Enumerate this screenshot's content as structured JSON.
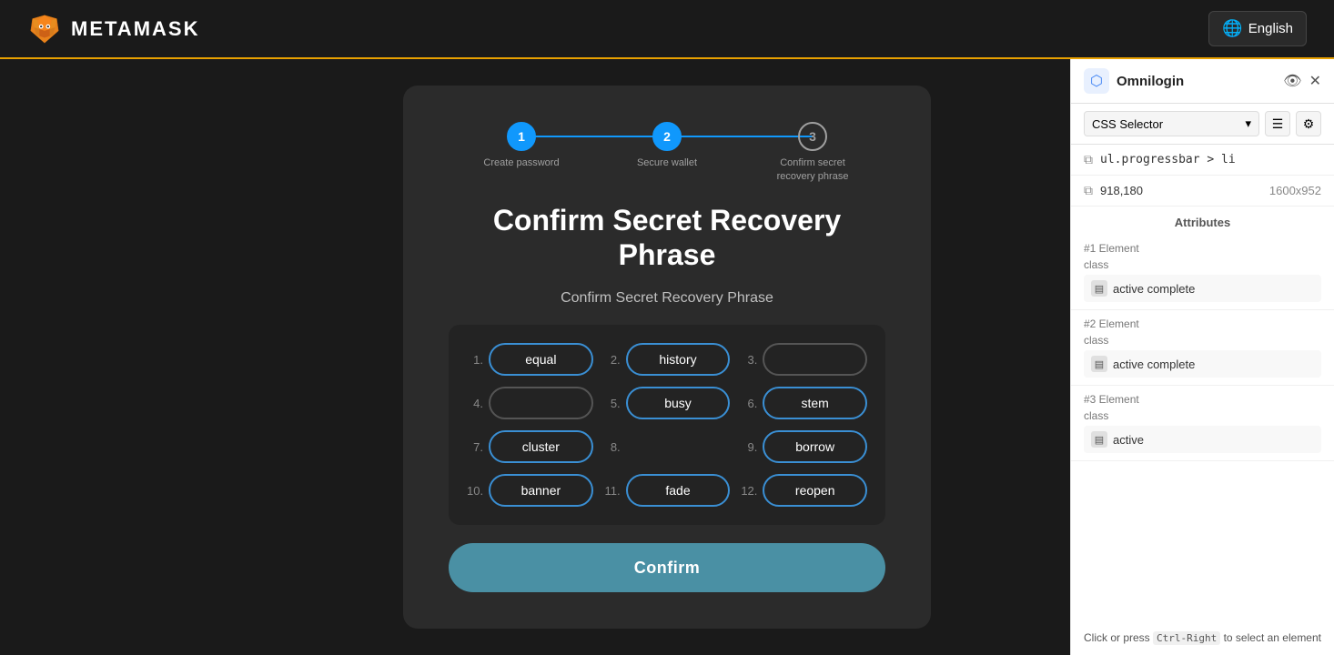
{
  "topbar": {
    "metamask_label": "METAMASK",
    "lang_label": "English"
  },
  "stepper": {
    "steps": [
      {
        "number": "1",
        "label": "Create password",
        "state": "done"
      },
      {
        "number": "2",
        "label": "Secure wallet",
        "state": "done"
      },
      {
        "number": "3",
        "label": "Confirm secret recovery phrase",
        "state": "active"
      }
    ]
  },
  "card": {
    "heading_main": "Confirm Secret Recovery Phrase",
    "heading_sub": "Confirm Secret Recovery Phrase",
    "words": [
      {
        "num": "1.",
        "word": "equal",
        "state": "filled"
      },
      {
        "num": "2.",
        "word": "history",
        "state": "filled"
      },
      {
        "num": "3.",
        "word": "",
        "state": "empty"
      },
      {
        "num": "4.",
        "word": "",
        "state": "empty"
      },
      {
        "num": "5.",
        "word": "busy",
        "state": "filled"
      },
      {
        "num": "6.",
        "word": "stem",
        "state": "filled"
      },
      {
        "num": "7.",
        "word": "cluster",
        "state": "filled"
      },
      {
        "num": "8.",
        "word": "",
        "state": "highlight"
      },
      {
        "num": "9.",
        "word": "borrow",
        "state": "filled"
      },
      {
        "num": "10.",
        "word": "banner",
        "state": "filled"
      },
      {
        "num": "11.",
        "word": "fade",
        "state": "filled"
      },
      {
        "num": "12.",
        "word": "reopen",
        "state": "filled"
      }
    ],
    "confirm_btn": "Confirm"
  },
  "omnilogin": {
    "title": "Omnilogin",
    "panel_label": "CSS Selector",
    "selector": "ul.progressbar > li",
    "coords": "918,180",
    "dimensions": "1600x952",
    "attributes_label": "Attributes",
    "elements": [
      {
        "label": "#1 Element",
        "class_label": "class",
        "class_value": "active complete"
      },
      {
        "label": "#2 Element",
        "class_label": "class",
        "class_value": "active complete"
      },
      {
        "label": "#3 Element",
        "class_label": "class",
        "class_value": "active"
      }
    ],
    "footer_text": "Click or press ",
    "footer_kbd": "Ctrl-Right",
    "footer_text2": " to select an element"
  }
}
